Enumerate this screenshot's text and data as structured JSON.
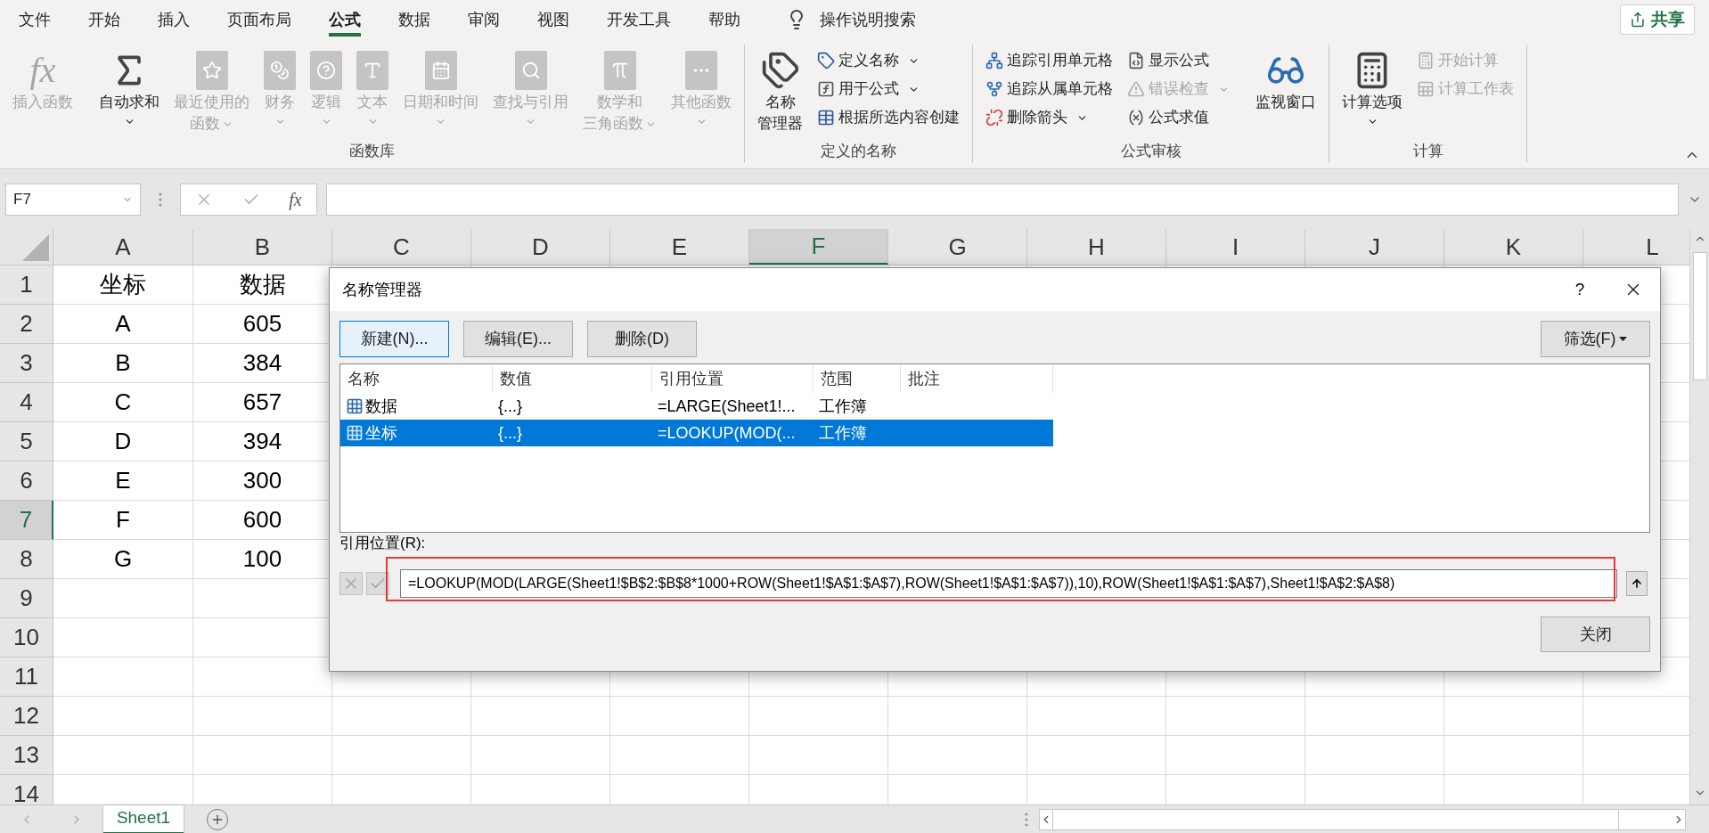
{
  "menu_tabs": [
    {
      "label": "文件",
      "selected": false
    },
    {
      "label": "开始",
      "selected": false
    },
    {
      "label": "插入",
      "selected": false
    },
    {
      "label": "页面布局",
      "selected": false
    },
    {
      "label": "公式",
      "selected": true
    },
    {
      "label": "数据",
      "selected": false
    },
    {
      "label": "审阅",
      "selected": false
    },
    {
      "label": "视图",
      "selected": false
    },
    {
      "label": "开发工具",
      "selected": false
    },
    {
      "label": "帮助",
      "selected": false
    }
  ],
  "tell_me": "操作说明搜索",
  "share_button": "共享",
  "ribbon_groups": [
    {
      "label": "函数库",
      "items": [
        {
          "kind": "large",
          "lines": [
            "插入函数"
          ],
          "glyph": "fx",
          "disabled": true,
          "dropdown": false
        },
        {
          "kind": "separator"
        },
        {
          "kind": "large",
          "lines": [
            "自动求和"
          ],
          "disabled": false,
          "dropdown": true
        },
        {
          "kind": "large",
          "lines": [
            "最近使用的",
            "函数"
          ],
          "disabled": true,
          "dropdown": true
        },
        {
          "kind": "large",
          "lines": [
            "财务"
          ],
          "disabled": true,
          "dropdown": true
        },
        {
          "kind": "large",
          "lines": [
            "逻辑"
          ],
          "disabled": true,
          "dropdown": true
        },
        {
          "kind": "large",
          "lines": [
            "文本"
          ],
          "disabled": true,
          "dropdown": true
        },
        {
          "kind": "large",
          "lines": [
            "日期和时间"
          ],
          "disabled": true,
          "dropdown": true
        },
        {
          "kind": "large",
          "lines": [
            "查找与引用"
          ],
          "disabled": true,
          "dropdown": true
        },
        {
          "kind": "large",
          "lines": [
            "数学和",
            "三角函数"
          ],
          "disabled": true,
          "dropdown": true
        },
        {
          "kind": "large",
          "lines": [
            "其他函数"
          ],
          "disabled": true,
          "dropdown": true
        }
      ]
    },
    {
      "label": "定义的名称",
      "items": [
        {
          "kind": "large",
          "lines": [
            "名称",
            "管理器"
          ],
          "disabled": false,
          "dropdown": false
        },
        {
          "kind": "small",
          "label": "定义名称",
          "disabled": false,
          "dropdown": true
        },
        {
          "kind": "small",
          "label": "用于公式",
          "disabled": false,
          "dropdown": true
        },
        {
          "kind": "small",
          "label": "根据所选内容创建",
          "disabled": false,
          "dropdown": false
        }
      ]
    },
    {
      "label": "公式审核",
      "items": [
        {
          "kind": "small",
          "label": "追踪引用单元格",
          "disabled": false,
          "dropdown": false
        },
        {
          "kind": "small",
          "label": "追踪从属单元格",
          "disabled": false,
          "dropdown": false
        },
        {
          "kind": "small",
          "label": "删除箭头",
          "disabled": false,
          "dropdown": true
        },
        {
          "kind": "small",
          "label": "显示公式",
          "disabled": false,
          "dropdown": false
        },
        {
          "kind": "small",
          "label": "错误检查",
          "disabled": true,
          "dropdown": true
        },
        {
          "kind": "small",
          "label": "公式求值",
          "disabled": false,
          "dropdown": false
        },
        {
          "kind": "separator"
        },
        {
          "kind": "large",
          "lines": [
            "监视窗口"
          ],
          "disabled": false,
          "dropdown": false
        }
      ]
    },
    {
      "label": "计算",
      "items": [
        {
          "kind": "large",
          "lines": [
            "计算选项"
          ],
          "disabled": false,
          "dropdown": true
        },
        {
          "kind": "small",
          "label": "开始计算",
          "disabled": true,
          "dropdown": false
        },
        {
          "kind": "small",
          "label": "计算工作表",
          "disabled": true,
          "dropdown": false
        }
      ]
    }
  ],
  "formula_bar": {
    "name_box": "F7",
    "function_glyph": "fx"
  },
  "columns": [
    {
      "label": "A",
      "selected": false
    },
    {
      "label": "B",
      "selected": false
    },
    {
      "label": "C",
      "selected": false
    },
    {
      "label": "D",
      "selected": false
    },
    {
      "label": "E",
      "selected": false
    },
    {
      "label": "F",
      "selected": true
    },
    {
      "label": "G",
      "selected": false
    },
    {
      "label": "H",
      "selected": false
    },
    {
      "label": "I",
      "selected": false
    },
    {
      "label": "J",
      "selected": false
    },
    {
      "label": "K",
      "selected": false
    },
    {
      "label": "L",
      "selected": false
    }
  ],
  "rows": [
    {
      "label": "1",
      "selected": false,
      "cells": [
        "坐标",
        "数据"
      ]
    },
    {
      "label": "2",
      "selected": false,
      "cells": [
        "A",
        "605"
      ]
    },
    {
      "label": "3",
      "selected": false,
      "cells": [
        "B",
        "384"
      ]
    },
    {
      "label": "4",
      "selected": false,
      "cells": [
        "C",
        "657"
      ]
    },
    {
      "label": "5",
      "selected": false,
      "cells": [
        "D",
        "394"
      ]
    },
    {
      "label": "6",
      "selected": false,
      "cells": [
        "E",
        "300"
      ]
    },
    {
      "label": "7",
      "selected": true,
      "cells": [
        "F",
        "600"
      ]
    },
    {
      "label": "8",
      "selected": false,
      "cells": [
        "G",
        "100"
      ]
    },
    {
      "label": "9",
      "selected": false
    },
    {
      "label": "10",
      "selected": false
    },
    {
      "label": "11",
      "selected": false
    },
    {
      "label": "12",
      "selected": false
    },
    {
      "label": "13",
      "selected": false
    },
    {
      "label": "14",
      "selected": false
    }
  ],
  "sheet_tabs": [
    {
      "label": "Sheet1",
      "selected": true
    }
  ],
  "dialog": {
    "title": "名称管理器",
    "help": "?",
    "buttons": [
      {
        "label": "新建(N)...",
        "focused": true
      },
      {
        "label": "编辑(E)...",
        "focused": false
      },
      {
        "label": "删除(D)",
        "focused": false
      }
    ],
    "filter_button": "筛选(F)",
    "columns": [
      "名称",
      "数值",
      "引用位置",
      "范围",
      "批注"
    ],
    "rows": [
      {
        "cells": [
          "数据",
          "{...}",
          "=LARGE(Sheet1!...",
          "工作簿"
        ],
        "selected": false
      },
      {
        "cells": [
          "坐标",
          "{...}",
          "=LOOKUP(MOD(...",
          "工作簿"
        ],
        "selected": true
      }
    ],
    "refers_to_label": "引用位置(R):",
    "refers_to": "=LOOKUP(MOD(LARGE(Sheet1!$B$2:$B$8*1000+ROW(Sheet1!$A$1:$A$7),ROW(Sheet1!$A$1:$A$7)),10),ROW(Sheet1!$A$1:$A$7),Sheet1!$A$2:$A$8)",
    "close_button": "关闭"
  }
}
